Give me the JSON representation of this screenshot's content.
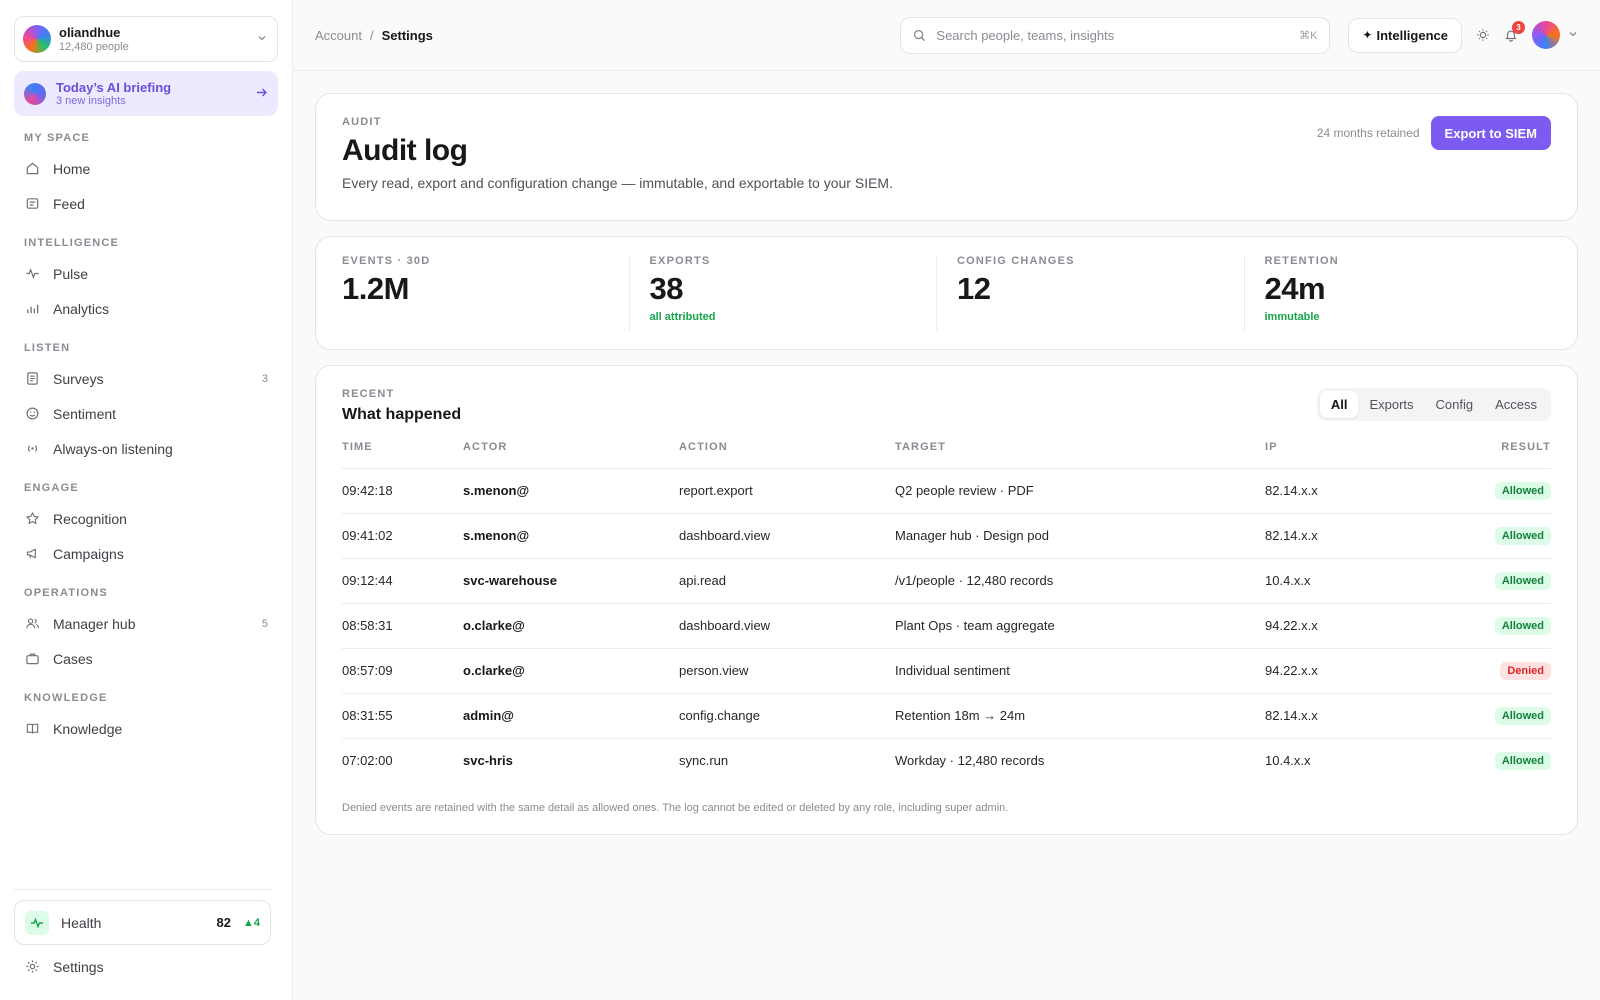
{
  "sidebar": {
    "org": {
      "name": "oliandhue",
      "sub": "12,480 people"
    },
    "briefing": {
      "title": "Today’s AI briefing",
      "sub": "3 new insights"
    },
    "sections": [
      {
        "head": "MY SPACE",
        "items": [
          {
            "label": "Home",
            "icon": "home-icon"
          },
          {
            "label": "Feed",
            "icon": "feed-icon"
          }
        ]
      },
      {
        "head": "INTELLIGENCE",
        "items": [
          {
            "label": "Pulse",
            "icon": "pulse-icon"
          },
          {
            "label": "Analytics",
            "icon": "bar-chart-icon"
          }
        ]
      },
      {
        "head": "LISTEN",
        "items": [
          {
            "label": "Surveys",
            "icon": "survey-icon",
            "count": "3"
          },
          {
            "label": "Sentiment",
            "icon": "smile-icon"
          },
          {
            "label": "Always-on listening",
            "icon": "broadcast-icon"
          }
        ]
      },
      {
        "head": "ENGAGE",
        "items": [
          {
            "label": "Recognition",
            "icon": "star-icon"
          },
          {
            "label": "Campaigns",
            "icon": "megaphone-icon"
          }
        ]
      },
      {
        "head": "OPERATIONS",
        "items": [
          {
            "label": "Manager hub",
            "icon": "users-icon",
            "count": "5"
          },
          {
            "label": "Cases",
            "icon": "briefcase-icon"
          }
        ]
      },
      {
        "head": "KNOWLEDGE",
        "items": [
          {
            "label": "Knowledge",
            "icon": "book-icon"
          }
        ]
      }
    ],
    "health": {
      "label": "Health",
      "value": "82",
      "delta": "▲4"
    },
    "settings": "Settings"
  },
  "topbar": {
    "crumbs": [
      "Account",
      "Settings"
    ],
    "crumb_sep": "/",
    "search_placeholder": "Search people, teams, insights",
    "search_kbd": "⌘K",
    "intel_label": "Intelligence",
    "notif_count": "3"
  },
  "hero": {
    "eyebrow": "AUDIT",
    "title": "Audit log",
    "desc": "Every read, export and configuration change — immutable, and exportable to your SIEM.",
    "retained": "24 months retained",
    "export_label": "Export to SIEM"
  },
  "stats": [
    {
      "label": "EVENTS · 30D",
      "value": "1.2M",
      "sub": ""
    },
    {
      "label": "EXPORTS",
      "value": "38",
      "sub": "all attributed"
    },
    {
      "label": "CONFIG CHANGES",
      "value": "12",
      "sub": ""
    },
    {
      "label": "RETENTION",
      "value": "24m",
      "sub": "immutable"
    }
  ],
  "recent": {
    "eyebrow": "RECENT",
    "title": "What happened",
    "filters": [
      "All",
      "Exports",
      "Config",
      "Access"
    ],
    "active_filter": "All",
    "columns": [
      "TIME",
      "ACTOR",
      "ACTION",
      "TARGET",
      "IP",
      "RESULT"
    ],
    "rows": [
      [
        "09:42:18",
        "s.menon@",
        "report.export",
        "Q2 people review · PDF",
        "82.14.x.x",
        "Allowed"
      ],
      [
        "09:41:02",
        "s.menon@",
        "dashboard.view",
        "Manager hub · Design pod",
        "82.14.x.x",
        "Allowed"
      ],
      [
        "09:12:44",
        "svc-warehouse",
        "api.read",
        "/v1/people · 12,480 records",
        "10.4.x.x",
        "Allowed"
      ],
      [
        "08:58:31",
        "o.clarke@",
        "dashboard.view",
        "Plant Ops · team aggregate",
        "94.22.x.x",
        "Allowed"
      ],
      [
        "08:57:09",
        "o.clarke@",
        "person.view",
        "Individual sentiment",
        "94.22.x.x",
        "Denied"
      ],
      [
        "08:31:55",
        "admin@",
        "config.change",
        "Retention 18m → 24m",
        "82.14.x.x",
        "Allowed"
      ],
      [
        "07:02:00",
        "svc-hris",
        "sync.run",
        "Workday · 12,480 records",
        "10.4.x.x",
        "Allowed"
      ]
    ],
    "footnote": "Denied events are retained with the same detail as allowed ones. The log cannot be edited or deleted by any role, including super admin."
  },
  "colors": {
    "accent": "#7c5cf0",
    "allowed": "#15803d",
    "denied": "#dc2626"
  }
}
